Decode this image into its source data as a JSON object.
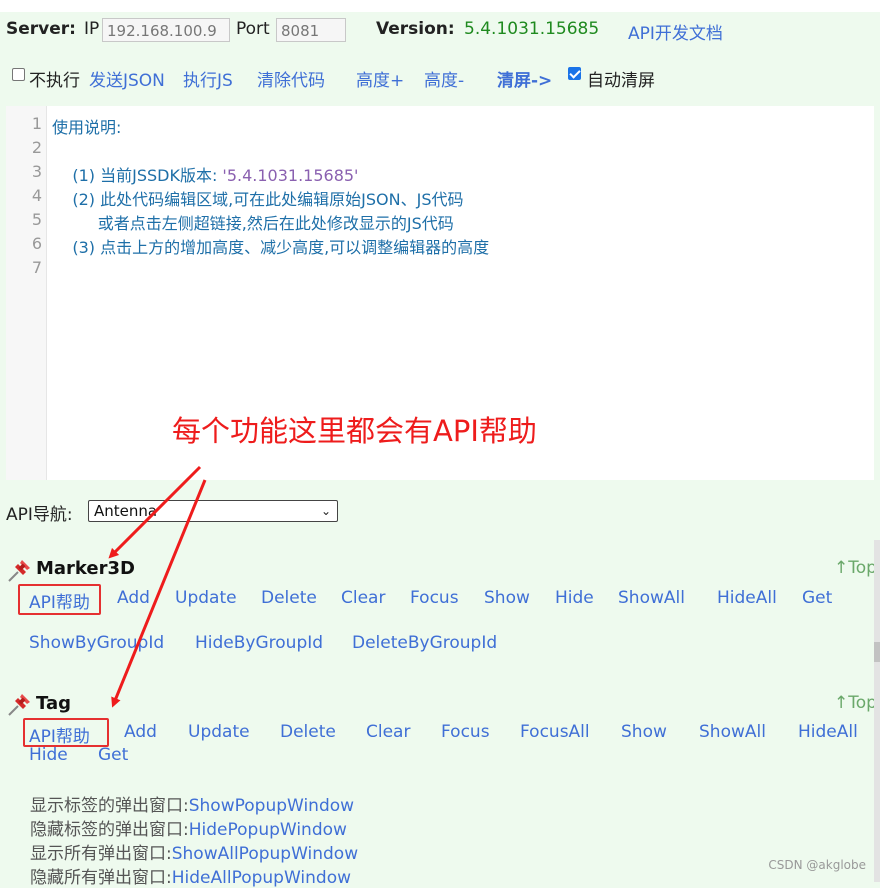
{
  "server": {
    "server_label": "Server:",
    "ip_label": "IP",
    "ip_value": "192.168.100.9",
    "port_label": "Port",
    "port_value": "8081",
    "version_label": "Version:",
    "version_value": "5.4.1031.15685",
    "api_doc_link": "API开发文档"
  },
  "toolbar": {
    "no_exec_label": "不执行",
    "no_exec_checked": false,
    "send_json": "发送JSON",
    "exec_js": "执行JS",
    "clear_code": "清除代码",
    "height_plus": "高度+",
    "height_minus": "高度-",
    "clear_screen": "清屏->",
    "auto_clear_label": "自动清屏",
    "auto_clear_checked": true
  },
  "editor": {
    "line_numbers": [
      "1",
      "2",
      "3",
      "4",
      "5",
      "6",
      "7"
    ],
    "lines": [
      "使用说明:",
      "",
      "    (1) 当前JSSDK版本: ",
      "    (2) 此处代码编辑区域,可在此处编辑原始JSON、JS代码",
      "         或者点击左侧超链接,然后在此处修改显示的JS代码",
      "    (3) 点击上方的增加高度、减少高度,可以调整编辑器的高度",
      ""
    ],
    "version_string": "'5.4.1031.15685'"
  },
  "annotation": "每个功能这里都会有API帮助",
  "api_nav": {
    "label": "API导航:",
    "selected": "Antenna"
  },
  "marker3d": {
    "title": "Marker3D",
    "top_link": "↑Top",
    "row1": [
      "API帮助",
      "Add",
      "Update",
      "Delete",
      "Clear",
      "Focus",
      "Show",
      "Hide",
      "ShowAll",
      "HideAll",
      "Get"
    ],
    "row2": [
      "ShowByGroupId",
      "HideByGroupId",
      "DeleteByGroupId"
    ]
  },
  "tag": {
    "title": "Tag",
    "top_link": "↑Top",
    "row1": [
      "API帮助",
      "Add",
      "Update",
      "Delete",
      "Clear",
      "Focus",
      "FocusAll",
      "Show",
      "ShowAll",
      "HideAll"
    ],
    "row2": [
      "Hide",
      "Get"
    ],
    "popup_rows": [
      {
        "label": "显示标签的弹出窗口:",
        "link": "ShowPopupWindow"
      },
      {
        "label": "隐藏标签的弹出窗口:",
        "link": "HidePopupWindow"
      },
      {
        "label": "显示所有弹出窗口:",
        "link": "ShowAllPopupWindow"
      },
      {
        "label": "隐藏所有弹出窗口:",
        "link": "HideAllPopupWindow"
      }
    ]
  },
  "watermark": "CSDN @akglobe",
  "colors": {
    "background": "#eefaee",
    "link": "#3f6fd6",
    "version_green": "#1f8a1f",
    "annotation_red": "#ee1c1c",
    "highlight_box": "#e53030"
  }
}
